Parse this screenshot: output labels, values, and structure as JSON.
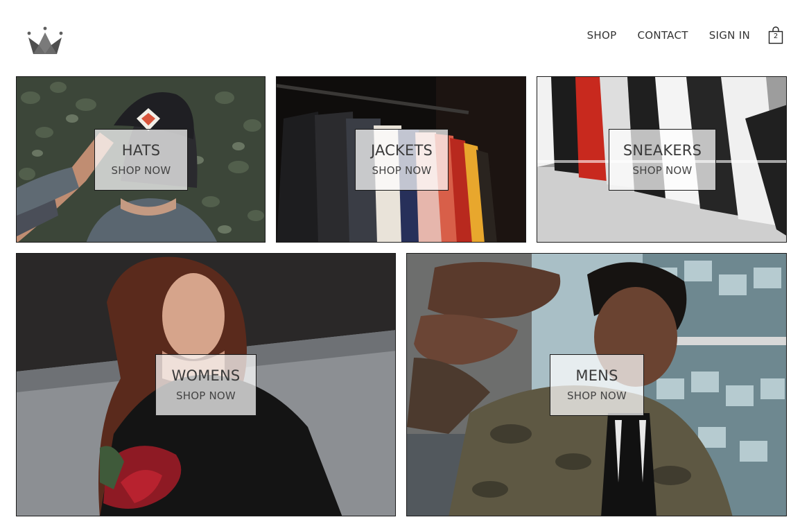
{
  "header": {
    "logo": "crown-logo",
    "nav": {
      "shop": "SHOP",
      "contact": "CONTACT",
      "sign_in": "SIGN IN"
    },
    "cart": {
      "icon": "shopping-bag-icon",
      "count": "2"
    }
  },
  "directory": [
    {
      "title": "HATS",
      "subtitle": "SHOP NOW"
    },
    {
      "title": "JACKETS",
      "subtitle": "SHOP NOW"
    },
    {
      "title": "SNEAKERS",
      "subtitle": "SHOP NOW"
    },
    {
      "title": "WOMENS",
      "subtitle": "SHOP NOW"
    },
    {
      "title": "MENS",
      "subtitle": "SHOP NOW"
    }
  ],
  "colors": {
    "text": "#333333",
    "logo": "#5f5f5f",
    "border": "#1a1a1a"
  }
}
